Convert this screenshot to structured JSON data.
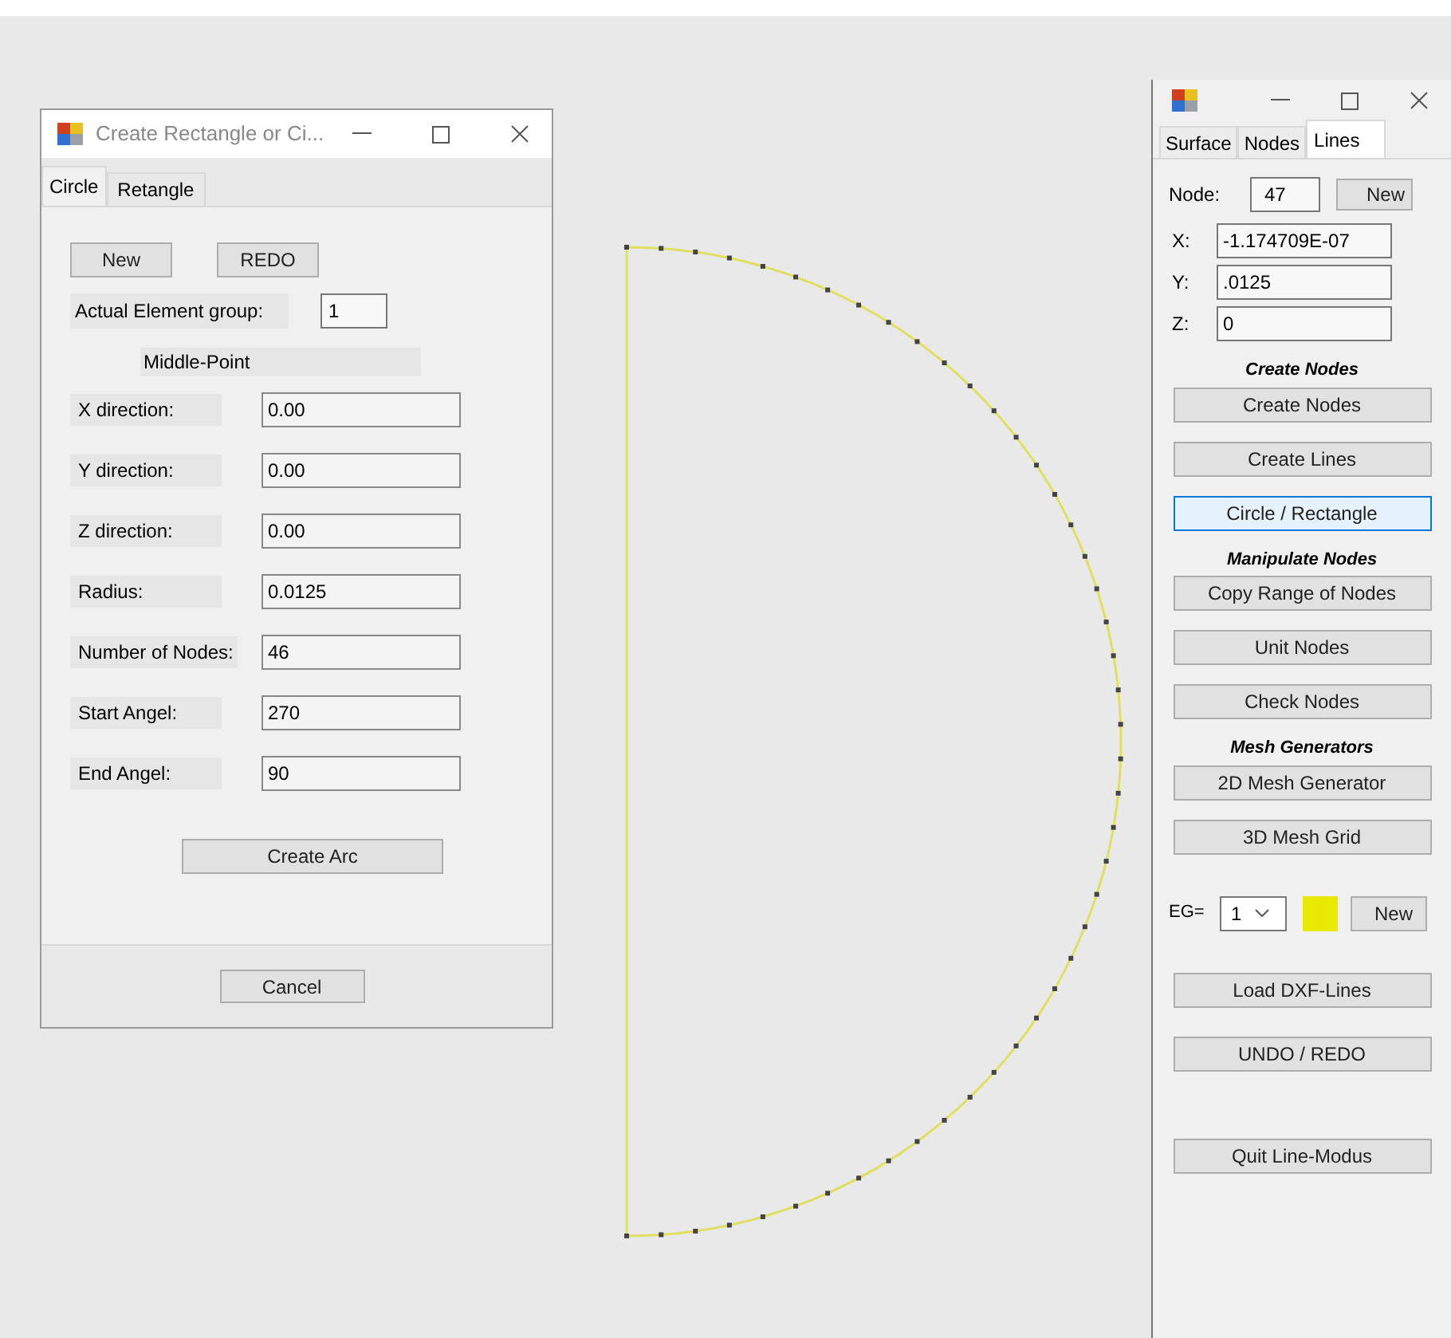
{
  "dialog": {
    "title": "Create Rectangle or Ci...",
    "tabs": [
      {
        "label": "Circle",
        "selected": true
      },
      {
        "label": "Retangle",
        "selected": false
      }
    ],
    "buttons": [
      "New",
      "REDO"
    ],
    "element_group": {
      "label": "Actual Element group:",
      "value": "1"
    },
    "section": "Middle-Point",
    "fields": [
      {
        "label": "X direction:",
        "value": "0.00"
      },
      {
        "label": "Y direction:",
        "value": "0.00"
      },
      {
        "label": "Z direction:",
        "value": "0.00"
      },
      {
        "label": "Radius:",
        "value": "0.0125"
      },
      {
        "label": "Number of Nodes:",
        "value": "46"
      },
      {
        "label": "Start Angel:",
        "value": "270"
      },
      {
        "label": "End Angel:",
        "value": "90"
      }
    ],
    "create_button": "Create Arc",
    "cancel_button": "Cancel"
  },
  "panel": {
    "tabs": [
      {
        "label": "Surface",
        "selected": false
      },
      {
        "label": "Nodes",
        "selected": false
      },
      {
        "label": "Lines",
        "selected": true
      }
    ],
    "node": {
      "label": "Node:",
      "value": "47",
      "button": "New"
    },
    "coords": [
      {
        "label": "X:",
        "value": "-1.174709E-07"
      },
      {
        "label": "Y:",
        "value": ".0125"
      },
      {
        "label": "Z:",
        "value": "0"
      }
    ],
    "groups": [
      {
        "heading": "Create Nodes",
        "buttons": [
          {
            "label": "Create Nodes",
            "focused": false
          },
          {
            "label": "Create Lines",
            "focused": false
          },
          {
            "label": "Circle / Rectangle",
            "focused": true
          }
        ]
      },
      {
        "heading": "Manipulate Nodes",
        "buttons": [
          {
            "label": "Copy Range of Nodes",
            "focused": false
          },
          {
            "label": "Unit Nodes",
            "focused": false
          },
          {
            "label": "Check Nodes",
            "focused": false
          }
        ]
      },
      {
        "heading": "Mesh Generators",
        "buttons": [
          {
            "label": "2D Mesh Generator",
            "focused": false
          },
          {
            "label": "3D Mesh Grid",
            "focused": false
          }
        ]
      }
    ],
    "eg": {
      "label": "EG=",
      "value": "1",
      "color": "#e8e800",
      "button": "New"
    },
    "bottom_buttons": [
      "Load DXF-Lines",
      "UNDO / REDO",
      "Quit Line-Modus"
    ]
  }
}
